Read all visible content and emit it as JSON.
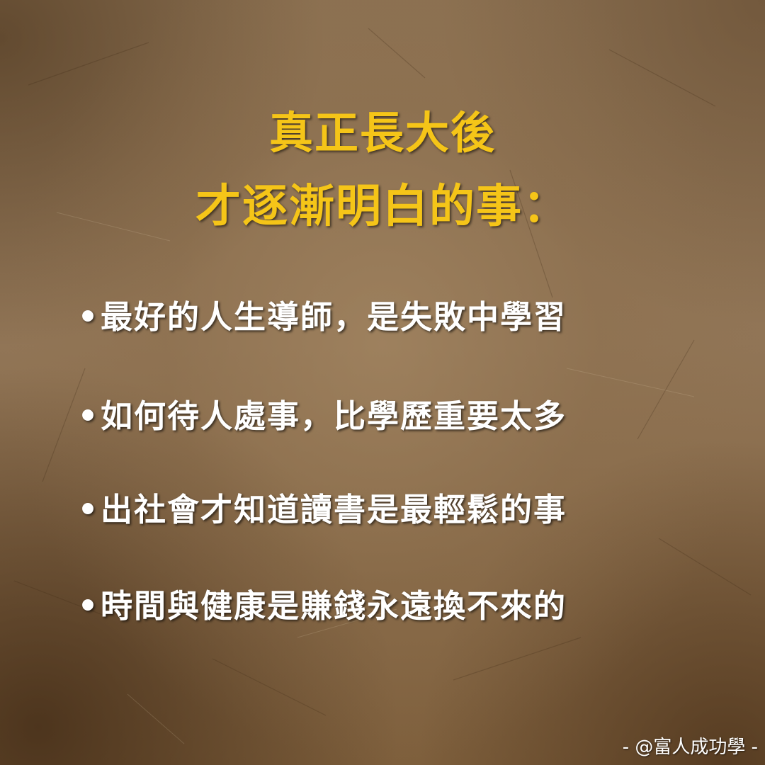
{
  "title": {
    "line1": "真正長大後",
    "line2": "才逐漸明白的事："
  },
  "bullet_marker": "•",
  "bullets": [
    "最好的人生導師，是失敗中學習",
    "如何待人處事，比學歷重要太多",
    "出社會才知道讀書是最輕鬆的事",
    "時間與健康是賺錢永遠換不來的"
  ],
  "watermark": "- @富人成功學 -",
  "colors": {
    "title": "#f5c518",
    "body_text": "#ffffff",
    "background": "#8c7152"
  }
}
